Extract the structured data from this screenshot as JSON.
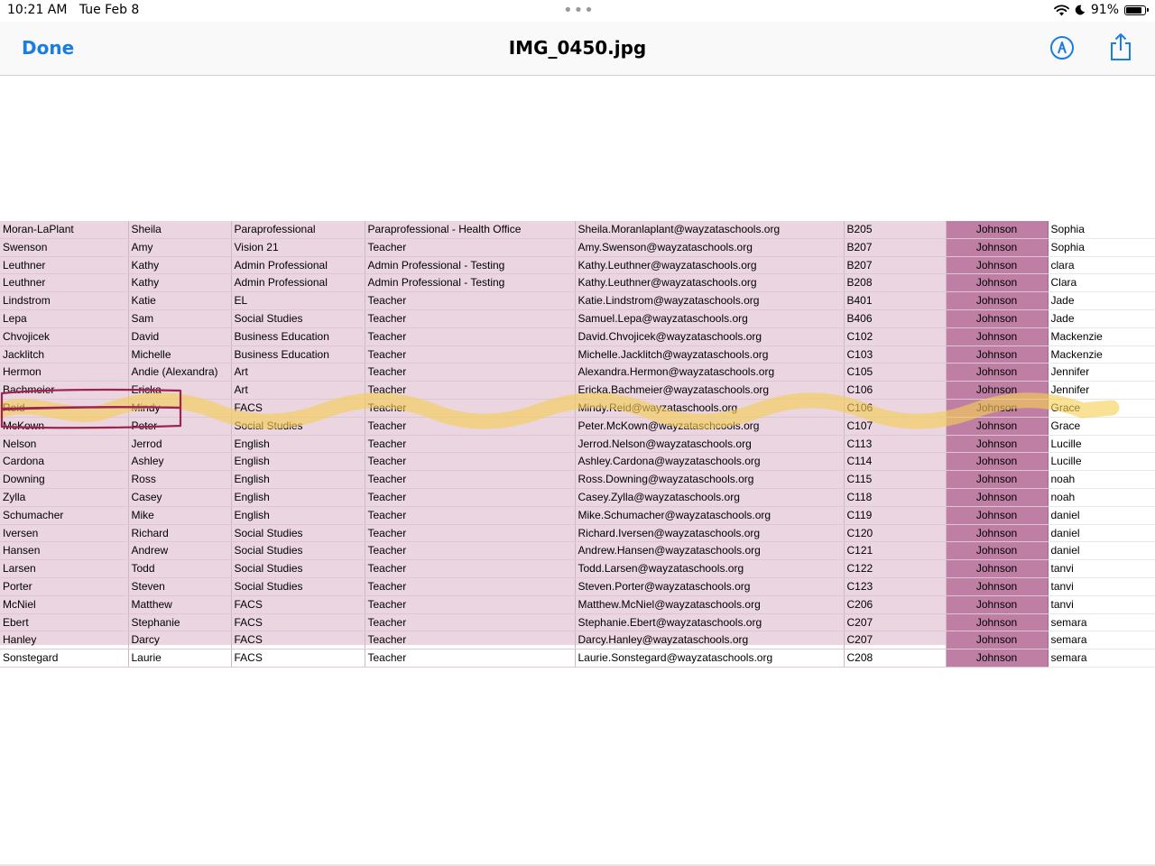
{
  "status_bar": {
    "time": "10:21 AM",
    "date": "Tue Feb 8",
    "battery_text": "91%",
    "battery_level": 0.91
  },
  "nav": {
    "done_label": "Done",
    "title": "IMG_0450.jpg"
  },
  "colors": {
    "accent": "#1a7ee0",
    "row_bg": "#ead5e0",
    "house_column": "#bf7ea4",
    "highlighter": "#f6cf55",
    "pen_mark": "#9b2450"
  },
  "icons": {
    "wifi": "wifi-icon",
    "moon": "moon-icon",
    "battery": "battery-icon",
    "markup": "markup-pen-icon",
    "share": "share-icon"
  },
  "table": {
    "rows": [
      [
        "Moran-LaPlant",
        "Sheila",
        "Paraprofessional",
        "Paraprofessional - Health Office",
        "Sheila.Moranlaplant@wayzataschools.org",
        "B205",
        "Johnson",
        "Sophia"
      ],
      [
        "Swenson",
        "Amy",
        "Vision 21",
        "Teacher",
        "Amy.Swenson@wayzataschools.org",
        "B207",
        "Johnson",
        "Sophia"
      ],
      [
        "Leuthner",
        "Kathy",
        "Admin Professional",
        "Admin Professional - Testing",
        "Kathy.Leuthner@wayzataschools.org",
        "B207",
        "Johnson",
        "clara"
      ],
      [
        "Leuthner",
        "Kathy",
        "Admin Professional",
        "Admin Professional - Testing",
        "Kathy.Leuthner@wayzataschools.org",
        "B208",
        "Johnson",
        "Clara"
      ],
      [
        "Lindstrom",
        "Katie",
        "EL",
        "Teacher",
        "Katie.Lindstrom@wayzataschools.org",
        "B401",
        "Johnson",
        "Jade"
      ],
      [
        "Lepa",
        "Sam",
        "Social Studies",
        "Teacher",
        "Samuel.Lepa@wayzataschools.org",
        "B406",
        "Johnson",
        "Jade"
      ],
      [
        "Chvojicek",
        "David",
        "Business Education",
        "Teacher",
        "David.Chvojicek@wayzataschools.org",
        "C102",
        "Johnson",
        "Mackenzie"
      ],
      [
        "Jacklitch",
        "Michelle",
        "Business Education",
        "Teacher",
        "Michelle.Jacklitch@wayzataschools.org",
        "C103",
        "Johnson",
        "Mackenzie"
      ],
      [
        "Hermon",
        "Andie (Alexandra)",
        "Art",
        "Teacher",
        "Alexandra.Hermon@wayzataschools.org",
        "C105",
        "Johnson",
        "Jennifer"
      ],
      [
        "Bachmeier",
        "Ericka",
        "Art",
        "Teacher",
        "Ericka.Bachmeier@wayzataschools.org",
        "C106",
        "Johnson",
        "Jennifer"
      ],
      [
        "Reid",
        "Mindy",
        "FACS",
        "Teacher",
        "Mindy.Reid@wayzataschools.org",
        "C106",
        "Johnson",
        "Grace"
      ],
      [
        "McKown",
        "Peter",
        "Social Studies",
        "Teacher",
        "Peter.McKown@wayzataschcools.org",
        "C107",
        "Johnson",
        "Grace"
      ],
      [
        "Nelson",
        "Jerrod",
        "English",
        "Teacher",
        "Jerrod.Nelson@wayzataschools.org",
        "C113",
        "Johnson",
        "Lucille"
      ],
      [
        "Cardona",
        "Ashley",
        "English",
        "Teacher",
        "Ashley.Cardona@wayzataschools.org",
        "C114",
        "Johnson",
        "Lucille"
      ],
      [
        "Downing",
        "Ross",
        "English",
        "Teacher",
        "Ross.Downing@wayzataschools.org",
        "C115",
        "Johnson",
        "noah"
      ],
      [
        "Zylla",
        "Casey",
        "English",
        "Teacher",
        "Casey.Zylla@wayzataschools.org",
        "C118",
        "Johnson",
        "noah"
      ],
      [
        "Schumacher",
        "Mike",
        "English",
        "Teacher",
        "Mike.Schumacher@wayzataschools.org",
        "C119",
        "Johnson",
        "daniel"
      ],
      [
        "Iversen",
        "Richard",
        "Social Studies",
        "Teacher",
        "Richard.Iversen@wayzataschools.org",
        "C120",
        "Johnson",
        "daniel"
      ],
      [
        "Hansen",
        "Andrew",
        "Social Studies",
        "Teacher",
        "Andrew.Hansen@wayzataschools.org",
        "C121",
        "Johnson",
        "daniel"
      ],
      [
        "Larsen",
        "Todd",
        "Social Studies",
        "Teacher",
        "Todd.Larsen@wayzataschools.org",
        "C122",
        "Johnson",
        "tanvi"
      ],
      [
        "Porter",
        "Steven",
        "Social Studies",
        "Teacher",
        "Steven.Porter@wayzataschools.org",
        "C123",
        "Johnson",
        "tanvi"
      ],
      [
        "McNiel",
        "Matthew",
        "FACS",
        "Teacher",
        "Matthew.McNiel@wayzataschools.org",
        "C206",
        "Johnson",
        "tanvi"
      ],
      [
        "Ebert",
        "Stephanie",
        "FACS",
        "Teacher",
        "Stephanie.Ebert@wayzataschools.org",
        "C207",
        "Johnson",
        "semara"
      ],
      [
        "Hanley",
        "Darcy",
        "FACS",
        "Teacher",
        "Darcy.Hanley@wayzataschools.org",
        "C207",
        "Johnson",
        "semara"
      ],
      [
        "Sonstegard",
        "Laurie",
        "FACS",
        "Teacher",
        "Laurie.Sonstegard@wayzataschools.org",
        "C208",
        "Johnson",
        "semara"
      ]
    ]
  }
}
